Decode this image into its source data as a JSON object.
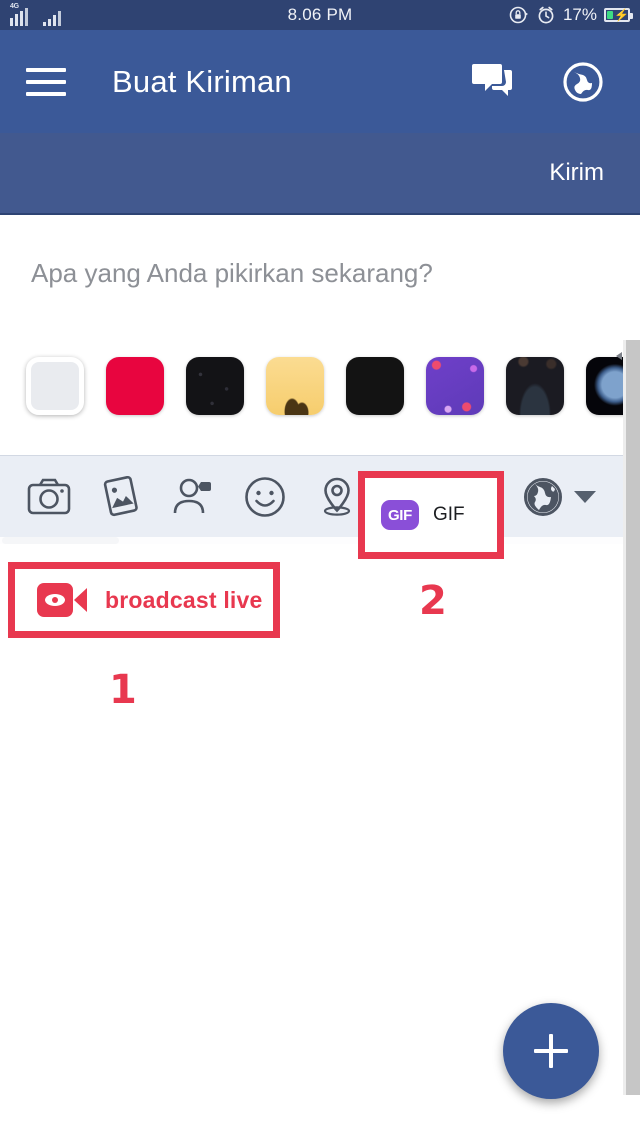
{
  "statusbar": {
    "network_label": "4G",
    "time": "8.06 PM",
    "battery_percent": "17%",
    "rotation_lock_icon": "rotation-lock-icon",
    "alarm_icon": "alarm-clock-icon",
    "battery_icon": "battery-charging-icon"
  },
  "appbar": {
    "menu_icon": "hamburger-menu-icon",
    "title": "Buat Kiriman",
    "messenger_icon": "chat-bubbles-icon",
    "globe_icon": "globe-notifications-icon"
  },
  "actionbar": {
    "submit_label": "Kirim"
  },
  "composer": {
    "placeholder": "Apa yang Anda pikirkan sekarang?"
  },
  "backgrounds": {
    "label": "post-background-swatches",
    "items": [
      {
        "name": "plain-white",
        "color": "#e9ebef",
        "selected": true
      },
      {
        "name": "crimson",
        "color": "#e8053f",
        "selected": false
      },
      {
        "name": "dark-speckled",
        "color": "#131316",
        "selected": false
      },
      {
        "name": "golden-sand",
        "color": "#f8d580",
        "selected": false
      },
      {
        "name": "black",
        "color": "#131313",
        "selected": false
      },
      {
        "name": "purple-confetti",
        "color": "#6b3fc4",
        "selected": false
      },
      {
        "name": "dark-navy",
        "color": "#1b1b22",
        "selected": false
      },
      {
        "name": "black-blue-moon",
        "color": "#05050a",
        "selected": false
      }
    ]
  },
  "toolbar": {
    "items": [
      {
        "name": "camera-icon",
        "label": "Kamera"
      },
      {
        "name": "photo-icon",
        "label": "Foto"
      },
      {
        "name": "tag-people-icon",
        "label": "Tandai Orang"
      },
      {
        "name": "emoji-icon",
        "label": "Perasaan"
      },
      {
        "name": "location-pin-icon",
        "label": "Check In"
      }
    ],
    "privacy": {
      "icon": "globe-privacy-icon",
      "caret": "chevron-down-icon"
    }
  },
  "annotations": {
    "accent_color": "#e8384f",
    "live": {
      "icon": "broadcast-live-camera-icon",
      "text": "broadcast live",
      "marker": "1"
    },
    "gif": {
      "badge_text": "GIF",
      "label": "GIF",
      "badge_color": "#8a4fd8",
      "marker": "2"
    }
  },
  "fab": {
    "name": "add-post-button",
    "icon": "plus-icon"
  }
}
